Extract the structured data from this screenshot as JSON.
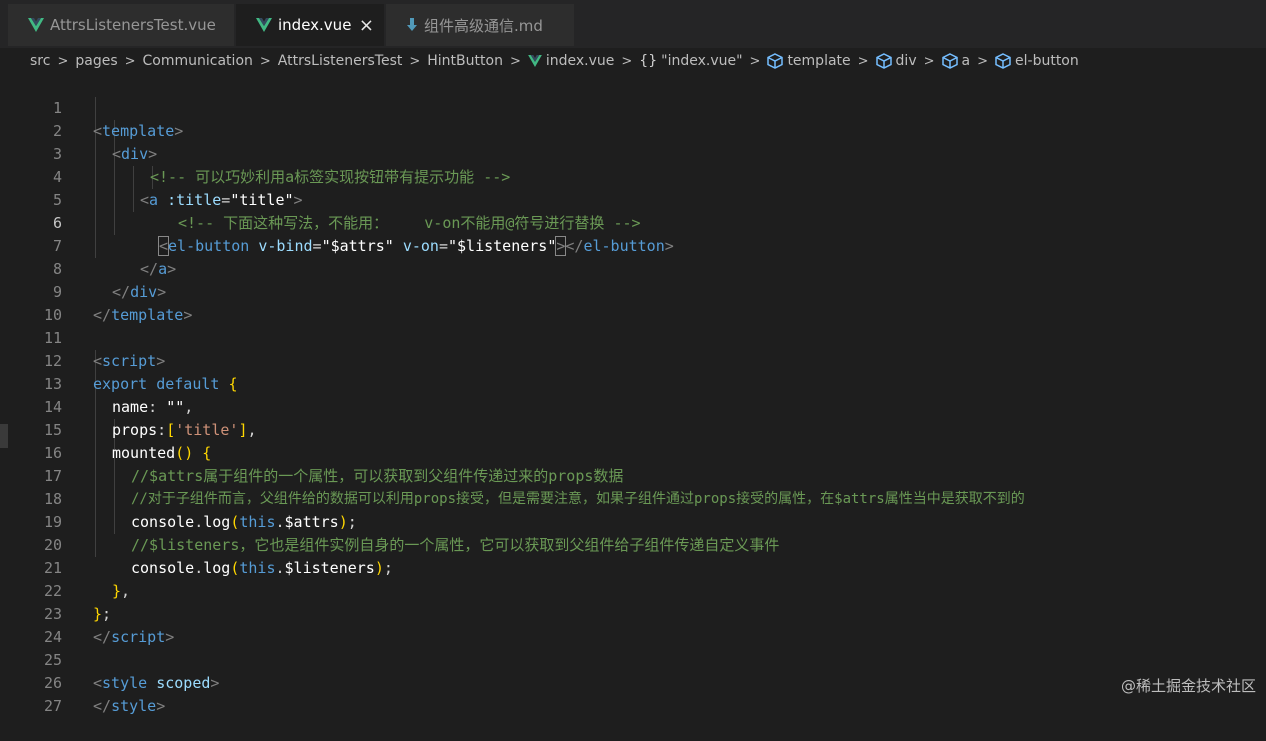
{
  "tabs": [
    {
      "label": "AttrsListenersTest.vue",
      "icon": "vue-icon",
      "active": false
    },
    {
      "label": "index.vue",
      "icon": "vue-icon",
      "active": true,
      "close": "×"
    },
    {
      "label": "组件高级通信.md",
      "icon": "markdown-icon",
      "active": false
    }
  ],
  "breadcrumb": {
    "items": [
      "src",
      "pages",
      "Communication",
      "AttrsListenersTest",
      "HintButton"
    ],
    "file": "index.vue",
    "braces": "{}",
    "symbol": "\"index.vue\"",
    "nodes": [
      "template",
      "div",
      "a",
      "el-button"
    ],
    "separator": ">"
  },
  "editor": {
    "line_numbers": [
      "1",
      "2",
      "3",
      "4",
      "5",
      "6",
      "7",
      "8",
      "9",
      "10",
      "11",
      "12",
      "13",
      "14",
      "15",
      "16",
      "17",
      "18",
      "19",
      "20",
      "21",
      "22",
      "23",
      "24",
      "25",
      "26",
      "27"
    ],
    "current_line": 6,
    "lines": {
      "l1": [
        "<",
        "template",
        ">"
      ],
      "l2": [
        "<",
        "div",
        ">"
      ],
      "l3": "<!-- 可以巧妙利用a标签实现按钮带有提示功能 -->",
      "l4": [
        "<",
        "a",
        " :title",
        "=",
        "\"title\"",
        ">"
      ],
      "l5": "<!-- 下面这种写法，不能用：    v-on不能用@符号进行替换 -->",
      "l6": [
        "<",
        "el-button",
        " v-bind",
        "=",
        "\"$attrs\"",
        " v-on",
        "=",
        "\"$listeners\"",
        ">",
        "</",
        "el-button",
        ">"
      ],
      "l7": [
        "</",
        "a",
        ">"
      ],
      "l8": [
        "</",
        "div",
        ">"
      ],
      "l9": [
        "</",
        "template",
        ">"
      ],
      "l11": [
        "<",
        "script",
        ">"
      ],
      "l12": [
        "export",
        " default",
        " {"
      ],
      "l13": [
        "name",
        ": ",
        "\"\"",
        ","
      ],
      "l14": [
        "props",
        ":",
        "[",
        "'title'",
        "]",
        ","
      ],
      "l15": [
        "mounted",
        "()",
        " {"
      ],
      "l16": "//$attrs属于组件的一个属性，可以获取到父组件传递过来的props数据",
      "l17": "//对于子组件而言，父组件给的数据可以利用props接受，但是需要注意，如果子组件通过props接受的属性，在$attrs属性当中是获取不到的",
      "l18": [
        "console",
        ".",
        "log",
        "(",
        "this",
        ".",
        "$attrs",
        ")",
        ";"
      ],
      "l19": "//$listeners，它也是组件实例自身的一个属性，它可以获取到父组件给子组件传递自定义事件",
      "l20": [
        "console",
        ".",
        "log",
        "(",
        "this",
        ".",
        "$listeners",
        ")",
        ";"
      ],
      "l21": [
        "}",
        ","
      ],
      "l22": [
        "}",
        ";"
      ],
      "l23": [
        "</",
        "script",
        ">"
      ],
      "l25": [
        "<",
        "style",
        " scoped",
        ">"
      ],
      "l26": [
        "</",
        "style",
        ">"
      ]
    }
  },
  "watermark": "@稀土掘金技术社区",
  "colors": {
    "background": "#1e1e1e",
    "tag": "#569cd6",
    "comment": "#6a9955",
    "attribute": "#9cdcfe",
    "string": "#ce9178",
    "vue_green": "#41b883"
  }
}
